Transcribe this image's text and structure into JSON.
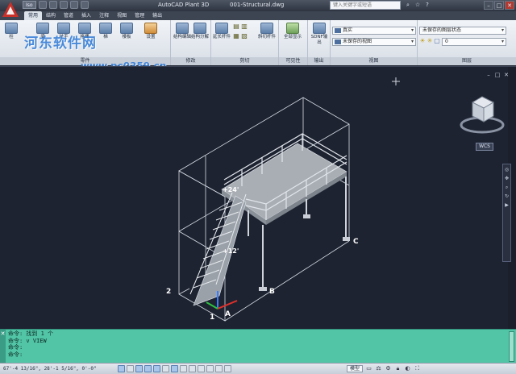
{
  "titlebar": {
    "app_title": "AutoCAD Plant 3D",
    "doc_title": "001-Structural.dwg",
    "workspace": "Iso",
    "search_placeholder": "键入关键字或短语"
  },
  "watermark": {
    "main": "河东软件网",
    "url": "www.pc0359.cn"
  },
  "tabs": [
    "常用",
    "结构",
    "管道",
    "插入",
    "注释",
    "视图",
    "管理",
    "输出"
  ],
  "ribbon": {
    "panels": [
      {
        "label": "零件",
        "buttons": [
          "柱",
          "梁",
          "扶手",
          "格栅",
          "梯",
          "楼板",
          "设置"
        ]
      },
      {
        "label": "修改",
        "buttons": [
          "结构编辑",
          "结构分解"
        ]
      },
      {
        "label": "剪切",
        "buttons": [
          "延长杆件",
          "修剪杆件",
          "斜切杆件"
        ]
      },
      {
        "label": "可见性",
        "buttons": [
          "全部显示"
        ]
      },
      {
        "label": "输出",
        "buttons": [
          "SDNF输出"
        ]
      },
      {
        "label": "视图",
        "fields": [
          "真实",
          "未保存的视图"
        ]
      },
      {
        "label": "图层",
        "fields": [
          "未保存的图层状态",
          "0"
        ]
      }
    ]
  },
  "viewport": {
    "wcs_label": "WCS",
    "labels": {
      "elev_top": "+24'",
      "elev_mid": "+12'",
      "p1": "1",
      "p2": "2",
      "pA": "A",
      "pB": "B",
      "pC": "C"
    }
  },
  "command": {
    "lines": [
      "命令: 找到 1 个",
      "命令: v VIEW",
      "命令:",
      "命令:"
    ]
  },
  "status": {
    "coords": "67'-4 13/16\", 28'-1 5/16\", 0'-0\"",
    "model_label": "模型"
  },
  "colors": {
    "viewport_bg": "#1e2331",
    "cmd_bg": "#52c5a7",
    "ribbon_bg": "#e6eaf0"
  }
}
